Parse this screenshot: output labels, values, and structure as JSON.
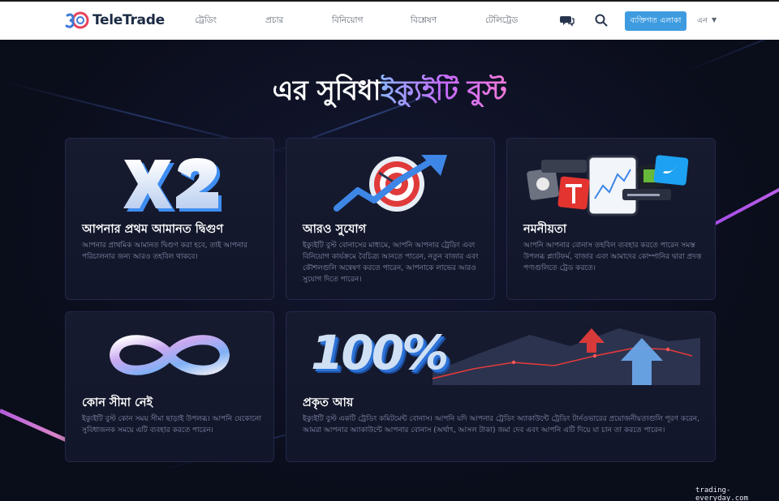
{
  "header": {
    "logo_text": "TeleTrade",
    "nav": [
      "ট্রেডিং",
      "প্রচার",
      "বিনিয়োগ",
      "বিশ্লেষণ",
      "টেলিট্রেড"
    ],
    "cta_label": "ব্যক্তিগত এলাকা",
    "language": "এন",
    "icons": [
      "chat-icon",
      "search-icon"
    ]
  },
  "hero": {
    "title_prefix": "এর সুবিধা",
    "title_highlight": "ইক্যুইটি বুস্ট"
  },
  "cards": [
    {
      "image": "x2-graphic",
      "title": "আপনার প্রথম আমানত দ্বিগুণ",
      "text": "আপনার প্রাথমিক আমানত দ্বিগুণ করা হবে, তাই আপনার পরিচালনার জন্য আরও তহবিল থাকবে।"
    },
    {
      "image": "target-arrow-graphic",
      "title": "আরও সুযোগ",
      "text": "ইক্যুইটি বুস্ট বোনাসের মাধ্যমে, আপনি আপনার ট্রেডিং এবং বিনিয়োগ কার্যক্রমে বৈচিত্র্য আনতে পারেন, নতুন বাজার এবং কৌশলগুলি অন্বেষণ করতে পারেন, আপনাকে লাভের আরও সুযোগ দিতে পারেন।"
    },
    {
      "image": "platform-logos-graphic",
      "title": "নমনীয়তা",
      "text": "আপনি আপনার বোনাস তহবিল ব্যবহার করতে পারেন সমস্ত উপলব্ধ প্ল্যাটফর্ম, বাজার এবং আমাদের কোম্পানির দ্বারা প্রদত্ত পণ্যগুলিতে ট্রেড করতে।"
    },
    {
      "image": "infinity-graphic",
      "title": "কোন সীমা নেই",
      "text": "ইক্যুইটি বুস্ট কোন সময় সীমা ছাড়াই উপলব্ধ। আপনি যেকোনো সুবিধাজনক সময়ে এটি ব্যবহার করতে পারেন।"
    },
    {
      "image": "percent-chart-graphic",
      "badge": "100%",
      "title": "প্রকৃত আয়",
      "text": "ইক্যুইটি বুস্ট একটি ট্রেডিং কমিটমেন্ট বোনাস। আপনি যদি আপনার ট্রেডিং অ্যাকাউন্টে ট্রেডিং টার্নওভারের প্রয়োজনীয়তাগুলি পূরণ করেন, আমরা আপনার অ্যাকাউন্টে আপনার বোনাস (অর্থাৎ, আসল টাকা) জমা দেব এবং আপনি এটি দিয়ে যা চান তা করতে পারেন।"
    }
  ],
  "watermark": "trading-everyday.com",
  "colors": {
    "background": "#0b0f1e",
    "card": "#161a2e",
    "accent_blue": "#3e9be0",
    "title_gradient": [
      "#8bb5ff",
      "#c56bff",
      "#f07ad8"
    ]
  }
}
